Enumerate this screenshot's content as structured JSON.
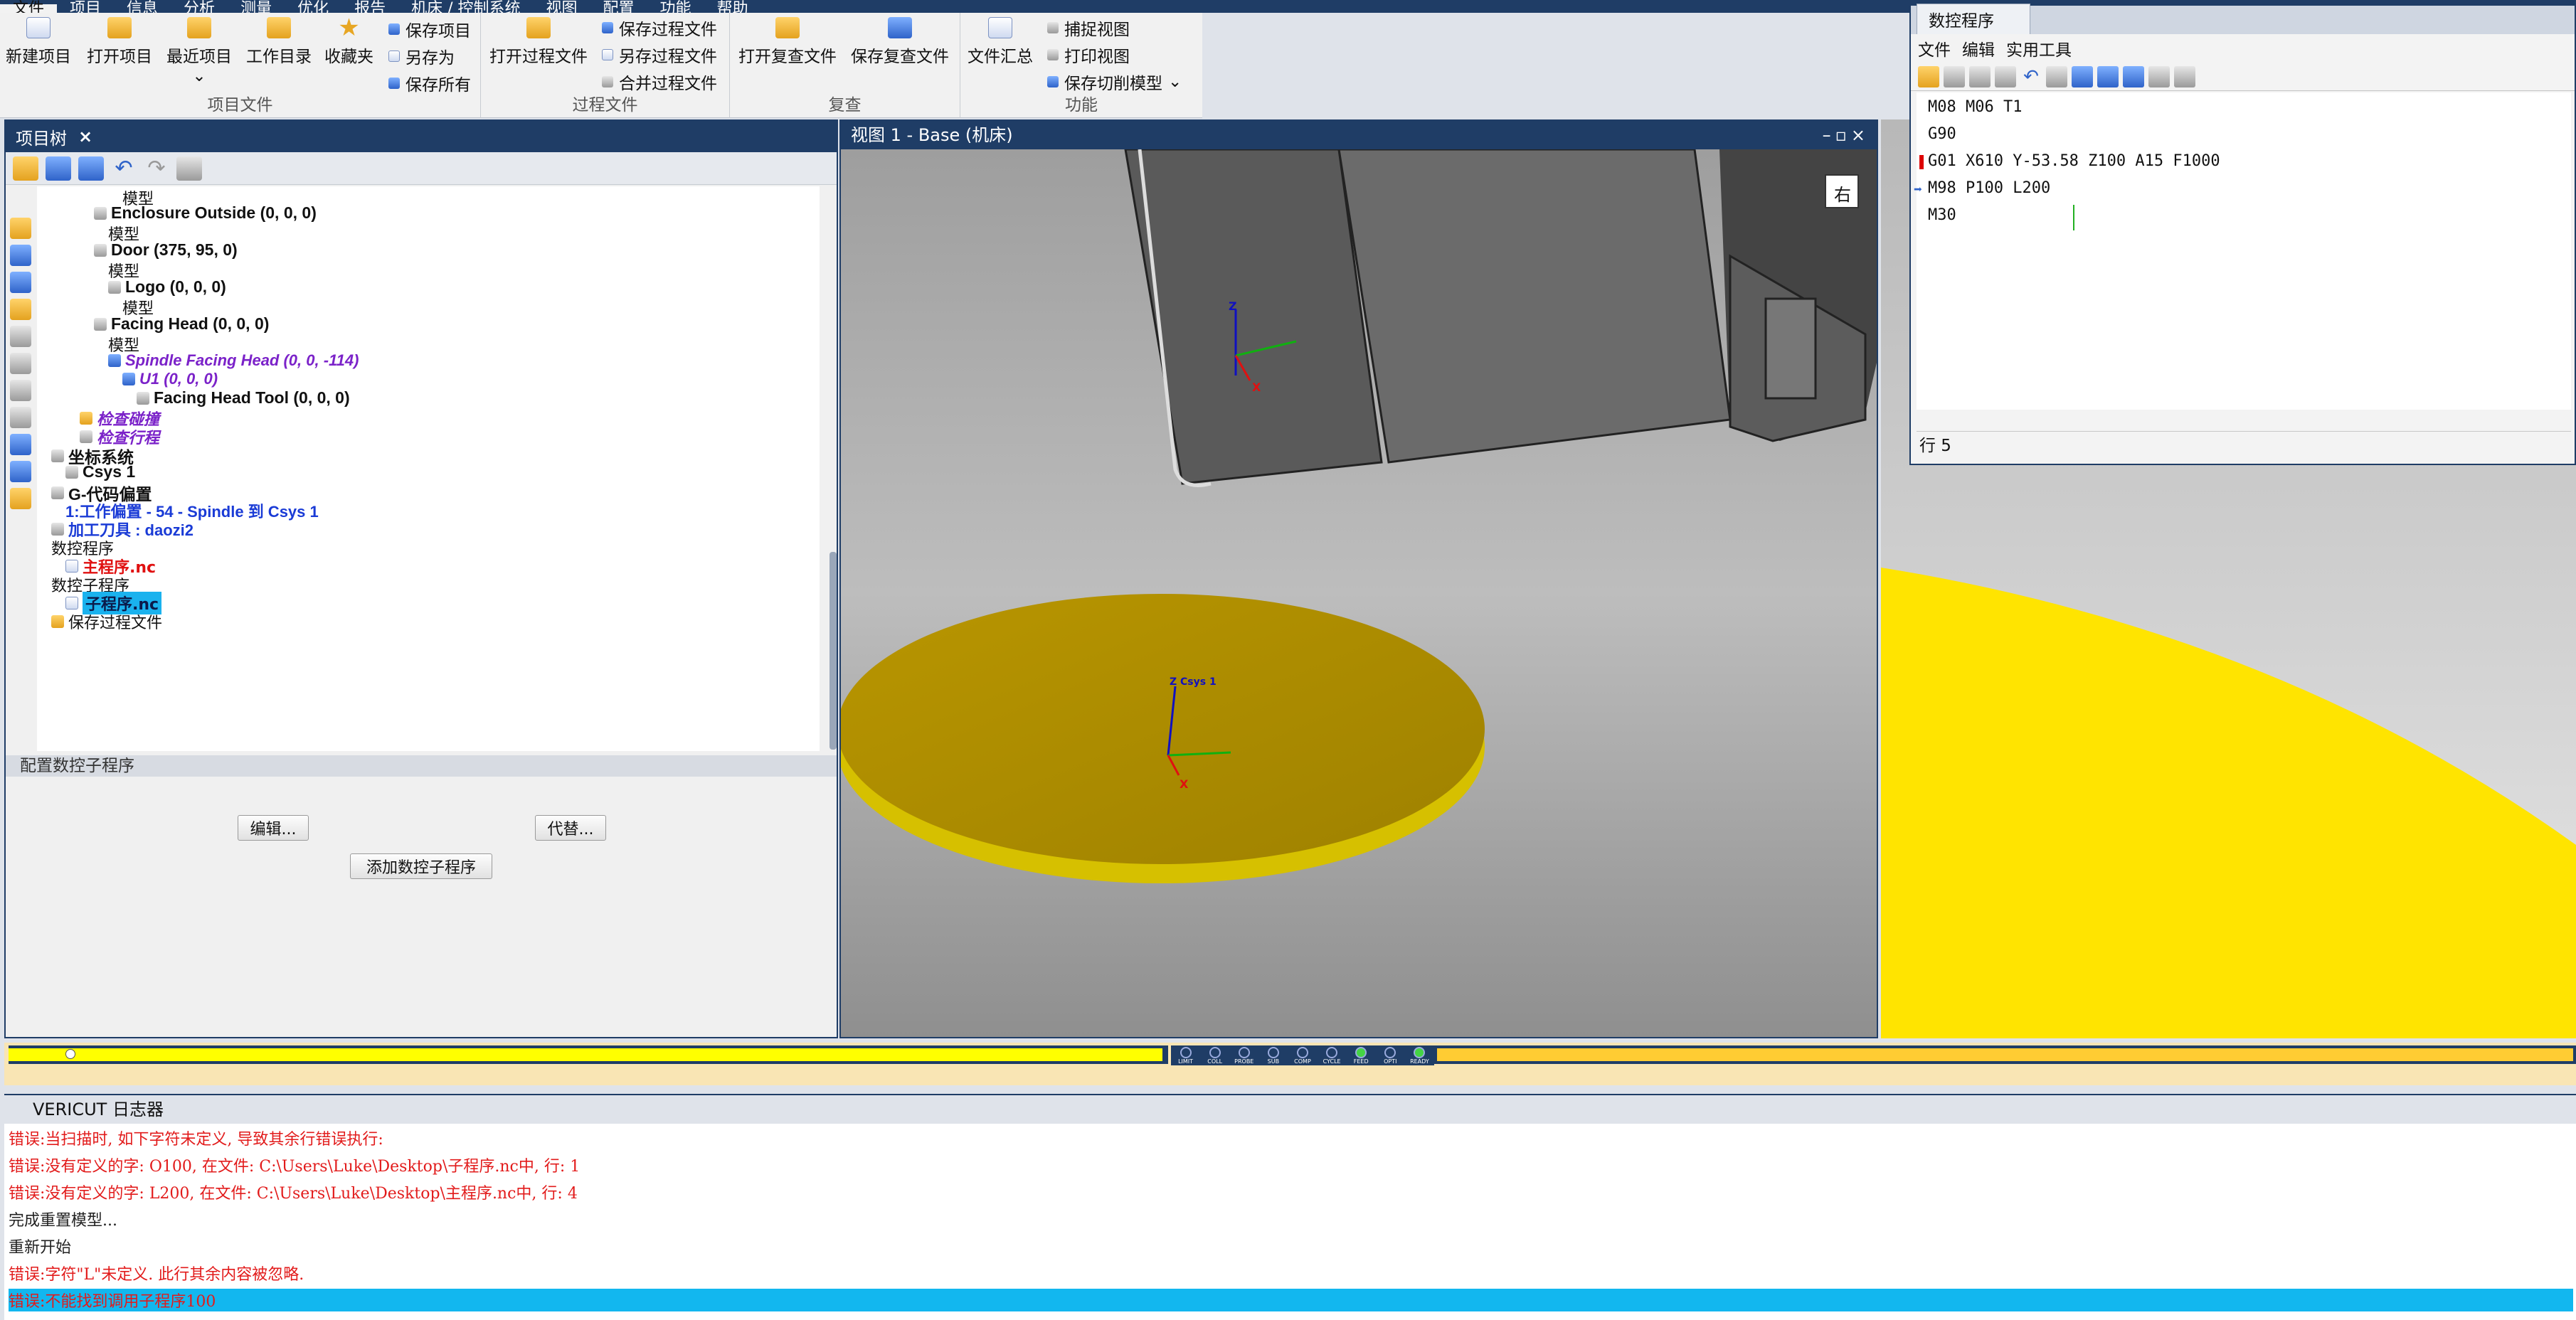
{
  "menubar": [
    "文件",
    "项目",
    "信息",
    "分析",
    "测量",
    "优化",
    "报告",
    "机床 / 控制系统",
    "视图",
    "配置",
    "功能",
    "帮助"
  ],
  "ribbon": {
    "project": {
      "caption": "项目文件",
      "new": "新建项目",
      "open": "打开项目",
      "recent": "最近项目",
      "workdir": "工作目录",
      "favorites": "收藏夹",
      "save": "保存项目",
      "saveas": "另存为",
      "saveall": "保存所有"
    },
    "process": {
      "caption": "过程文件",
      "open": "打开过程文件",
      "save": "保存过程文件",
      "saveas": "另存过程文件",
      "merge": "合并过程文件"
    },
    "review": {
      "caption": "复查",
      "open": "打开复查文件",
      "save": "保存复查文件"
    },
    "functions": {
      "caption": "功能",
      "summary": "文件汇总",
      "capture": "捕捉视图",
      "print": "打印视图",
      "savecut": "保存切削模型"
    }
  },
  "project_tree": {
    "title": "项目树",
    "items": [
      "模型",
      "Enclosure Outside (0, 0, 0)",
      "模型",
      "Door (375, 95, 0)",
      "模型",
      "Logo (0, 0, 0)",
      "模型",
      "Facing Head (0, 0, 0)",
      "模型",
      "Spindle Facing Head (0, 0, -114)",
      "U1 (0, 0, 0)",
      "Facing Head Tool (0, 0, 0)",
      "检查碰撞",
      "检查行程",
      "坐标系统",
      "Csys 1",
      "G-代码偏置",
      "1:工作偏置 - 54 - Spindle 到 Csys 1",
      "加工刀具 : daozi2",
      "数控程序",
      "主程序.nc",
      "数控子程序",
      "子程序.nc",
      "保存过程文件"
    ],
    "config_header": "配置数控子程序",
    "edit_btn": "编辑...",
    "replace_btn": "代替...",
    "add_btn": "添加数控子程序"
  },
  "view": {
    "title": "视图 1 - Base (机床)",
    "csys_top": "Z",
    "csys_top_x": "X",
    "csys_bottom": "Z Csys 1",
    "csys_bottom_x": "X",
    "viewcube": "右"
  },
  "nc_program": {
    "tab": "数控程序",
    "menu": [
      "文件",
      "编辑",
      "实用工具"
    ],
    "lines": [
      "M08 M06 T1",
      "G90",
      "G01 X610 Y-53.58 Z100 A15 F1000",
      "M98 P100 L200",
      "M30"
    ],
    "status": "行 5"
  },
  "progress": {
    "fraction": 0.047,
    "leds": [
      {
        "label": "LIMIT",
        "on": false
      },
      {
        "label": "COLL",
        "on": false
      },
      {
        "label": "PROBE",
        "on": false
      },
      {
        "label": "SUB",
        "on": false
      },
      {
        "label": "COMP",
        "on": false
      },
      {
        "label": "CYCLE",
        "on": false
      },
      {
        "label": "FEED",
        "on": true
      },
      {
        "label": "OPTI",
        "on": false
      },
      {
        "label": "READY",
        "on": true
      }
    ]
  },
  "log": {
    "title": "VERICUT 日志器",
    "lines": [
      {
        "text": "错误:当扫描时, 如下字符未定义, 导致其余行错误执行:",
        "type": "err"
      },
      {
        "text": "错误:没有定义的字: O100, 在文件: C:\\Users\\Luke\\Desktop\\子程序.nc中, 行: 1",
        "type": "err"
      },
      {
        "text": "错误:没有定义的字: L200, 在文件: C:\\Users\\Luke\\Desktop\\主程序.nc中, 行: 4",
        "type": "err"
      },
      {
        "text": "完成重置模型...",
        "type": "ok"
      },
      {
        "text": "重新开始",
        "type": "ok"
      },
      {
        "text": "错误:字符\"L\"未定义. 此行其余内容被忽略.",
        "type": "err"
      },
      {
        "text": "错误:不能找到调用子程序100",
        "type": "hl"
      }
    ]
  },
  "colors": {
    "frame": "#1f3d66",
    "part": "#c8a000",
    "highlight": "#12b7ef",
    "error": "#e21b1b"
  }
}
